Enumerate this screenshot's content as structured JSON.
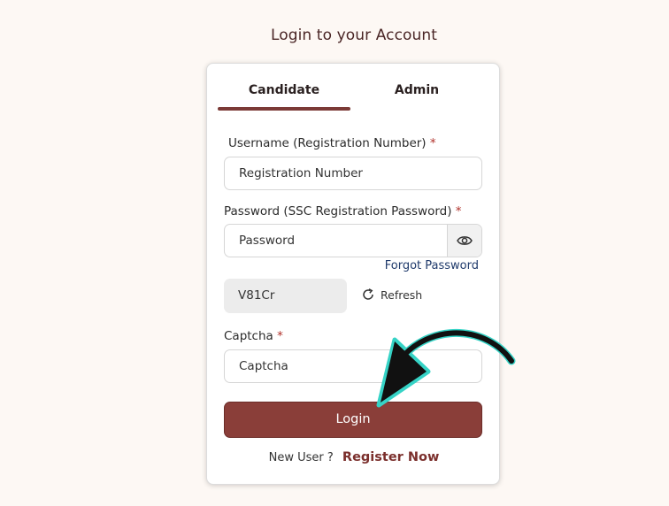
{
  "page": {
    "title": "Login to your Account"
  },
  "tabs": [
    {
      "label": "Candidate",
      "active": true
    },
    {
      "label": "Admin",
      "active": false
    }
  ],
  "form": {
    "username_label": "Username (Registration Number)",
    "username_placeholder": "Registration Number",
    "password_label": "Password (SSC Registration Password)",
    "password_placeholder": "Password",
    "required_mark": "*",
    "forgot_password": "Forgot Password",
    "captcha_code": "V81Cr",
    "refresh_label": "Refresh",
    "captcha_label": "Captcha",
    "captcha_placeholder": "Captcha",
    "login_button": "Login",
    "new_user_text": "New User ?",
    "register_link": "Register Now"
  },
  "icons": {
    "eye": "eye-icon",
    "refresh": "refresh-icon",
    "pointer": "arrow-annotation-icon"
  },
  "colors": {
    "accent": "#8a3e39",
    "link": "#1f3a6b",
    "required": "#b0302a",
    "annotation_glow": "#36d3c6"
  }
}
